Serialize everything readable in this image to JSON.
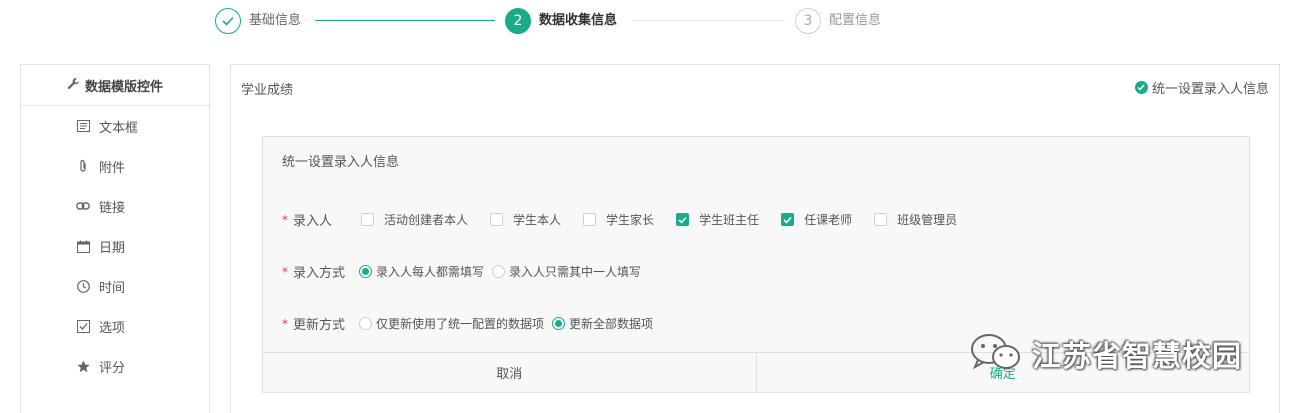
{
  "stepper": {
    "steps": [
      {
        "label": "基础信息",
        "state": "done"
      },
      {
        "label": "数据收集信息",
        "number": "2",
        "state": "active"
      },
      {
        "label": "配置信息",
        "number": "3",
        "state": "todo"
      }
    ]
  },
  "sidebar": {
    "header": {
      "icon": "wrench-icon",
      "label": "数据模版控件"
    },
    "items": [
      {
        "icon": "textbox-icon",
        "label": "文本框"
      },
      {
        "icon": "paperclip-icon",
        "label": "附件"
      },
      {
        "icon": "link-icon",
        "label": "链接"
      },
      {
        "icon": "calendar-icon",
        "label": "日期"
      },
      {
        "icon": "clock-icon",
        "label": "时间"
      },
      {
        "icon": "checkbox-icon",
        "label": "选项"
      },
      {
        "icon": "star-icon",
        "label": "评分"
      }
    ]
  },
  "main": {
    "title": "学业成绩",
    "unified_setting": "统一设置录入人信息"
  },
  "dialog": {
    "title": "统一设置录入人信息",
    "enterer": {
      "label": "录入人",
      "options": [
        {
          "label": "活动创建者本人",
          "checked": false
        },
        {
          "label": "学生本人",
          "checked": false
        },
        {
          "label": "学生家长",
          "checked": false
        },
        {
          "label": "学生班主任",
          "checked": true
        },
        {
          "label": "任课老师",
          "checked": true
        },
        {
          "label": "班级管理员",
          "checked": false
        }
      ]
    },
    "entry_mode": {
      "label": "录入方式",
      "options": [
        {
          "label": "录入人每人都需填写",
          "selected": true
        },
        {
          "label": "录入人只需其中一人填写",
          "selected": false
        }
      ]
    },
    "update_mode": {
      "label": "更新方式",
      "options": [
        {
          "label": "仅更新使用了统一配置的数据项",
          "selected": false
        },
        {
          "label": "更新全部数据项",
          "selected": true
        }
      ]
    },
    "cancel_label": "取消",
    "ok_label": "确定"
  },
  "watermark": {
    "text": "江苏省智慧校园"
  },
  "colors": {
    "accent": "#1aab8a",
    "required": "#e04040"
  }
}
